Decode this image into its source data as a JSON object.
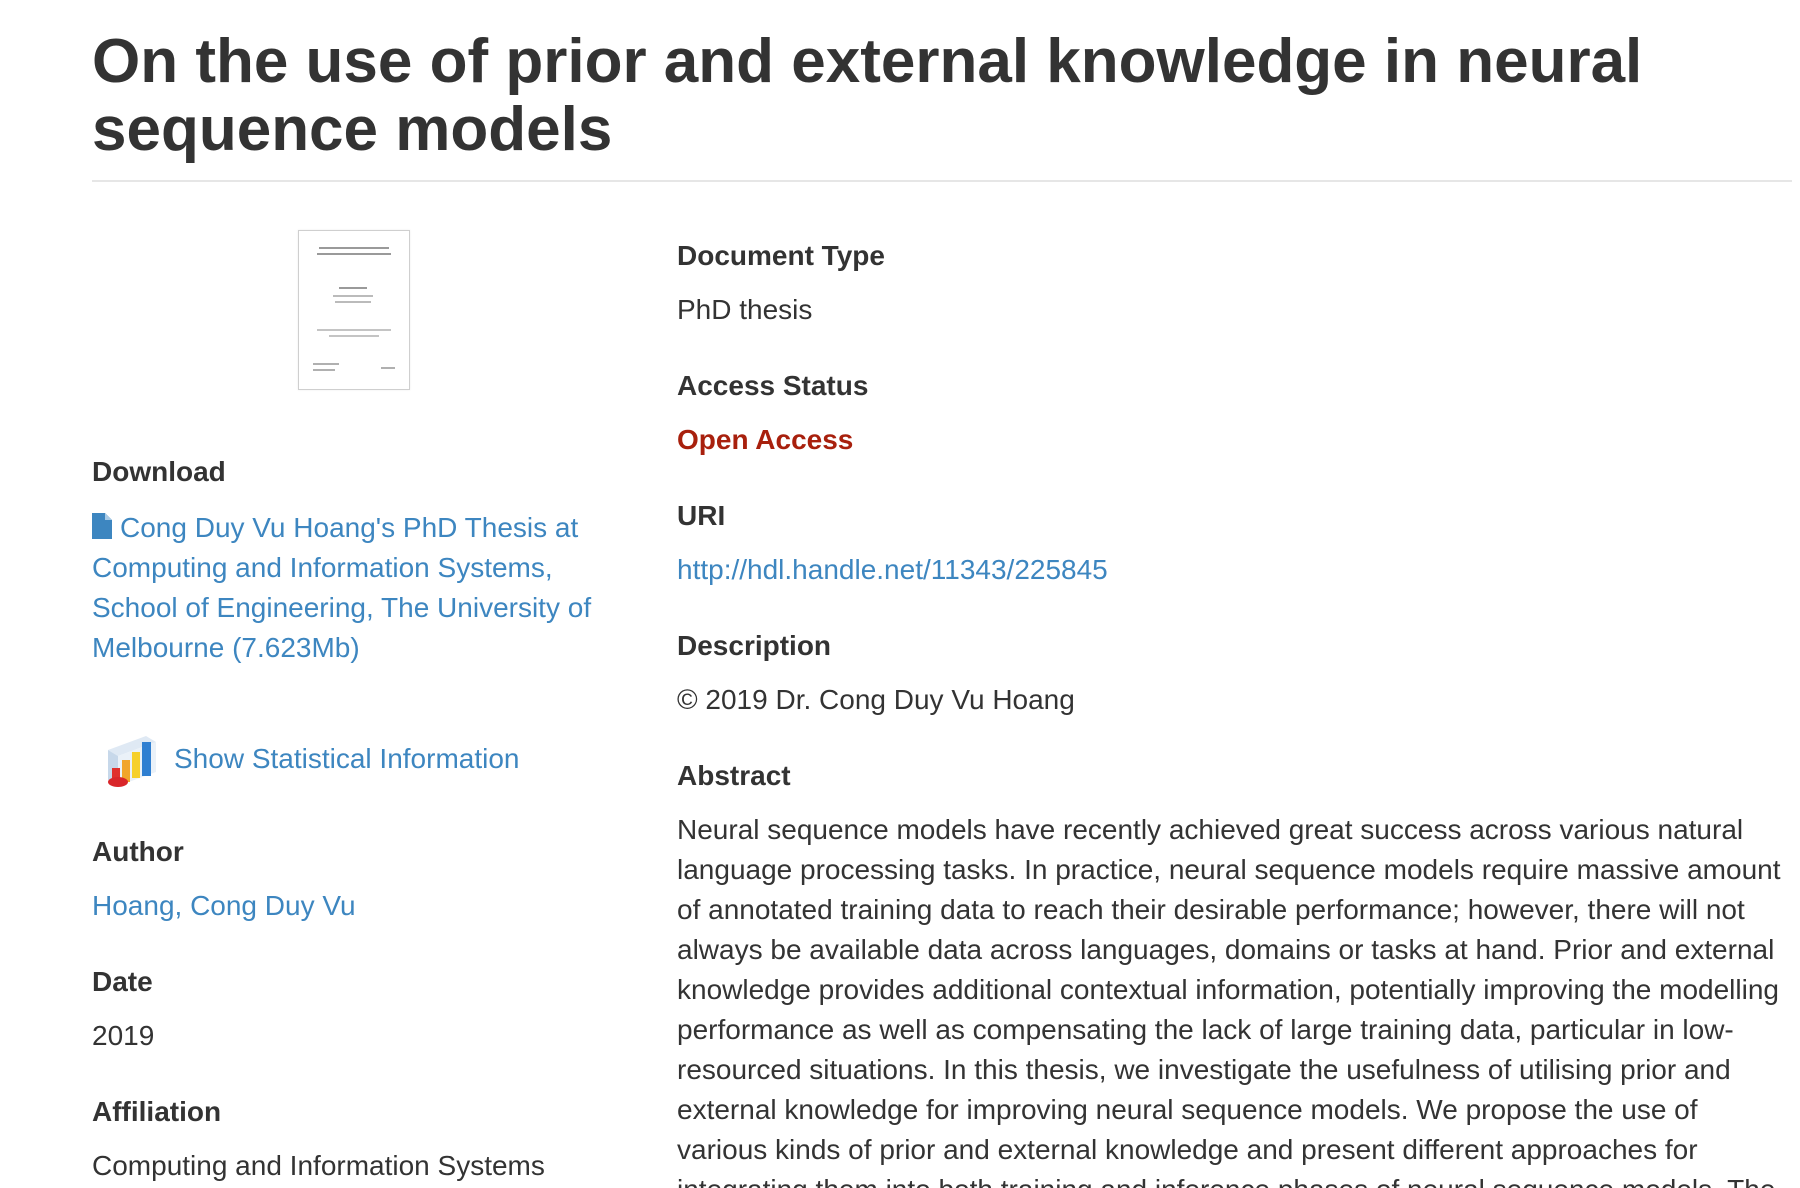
{
  "title": "On the use of prior and external knowledge in neural sequence models",
  "download": {
    "heading": "Download",
    "icon": "file-icon",
    "link_text": "Cong Duy Vu Hoang's PhD Thesis at Computing and Information Systems, School of Engineering, The University of Melbourne (7.623Mb)"
  },
  "statistics": {
    "icon": "bar-chart-icon",
    "link_text": "Show Statistical Information"
  },
  "author": {
    "heading": "Author",
    "value": "Hoang, Cong Duy Vu"
  },
  "date": {
    "heading": "Date",
    "value": "2019"
  },
  "affiliation": {
    "heading": "Affiliation",
    "value": "Computing and Information Systems"
  },
  "document_type": {
    "heading": "Document Type",
    "value": "PhD thesis"
  },
  "access_status": {
    "heading": "Access Status",
    "value": "Open Access"
  },
  "uri": {
    "heading": "URI",
    "value": "http://hdl.handle.net/11343/225845"
  },
  "description": {
    "heading": "Description",
    "value": "© 2019 Dr. Cong Duy Vu Hoang"
  },
  "abstract": {
    "heading": "Abstract",
    "text": "Neural sequence models have recently achieved great success across various natural language processing tasks. In practice, neural sequence models require massive amount of annotated training data to reach their desirable performance; however, there will not always be available data across languages, domains or tasks at hand. Prior and external knowledge provides additional contextual information, potentially improving the modelling performance as well as compensating the lack of large training data, particular in low-resourced situations. In this thesis, we investigate the usefulness of utilising prior and external knowledge for improving neural sequence models. We propose the use of various kinds of prior and external knowledge and present different approaches for integrating them into both training and inference phases of neural sequence models. The"
  },
  "colors": {
    "link": "#3d86c0",
    "open_access": "#a8200d",
    "text": "#333333"
  }
}
